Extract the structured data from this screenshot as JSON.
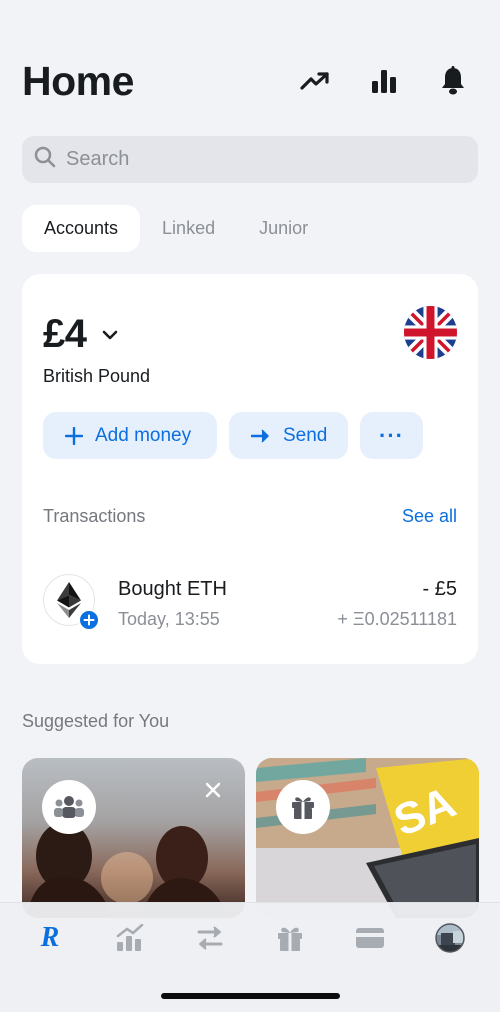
{
  "header": {
    "title": "Home",
    "icons": [
      "trending-up-icon",
      "bar-chart-icon",
      "bell-icon"
    ]
  },
  "search": {
    "placeholder": "Search",
    "value": ""
  },
  "tabs": [
    {
      "label": "Accounts",
      "active": true
    },
    {
      "label": "Linked",
      "active": false
    },
    {
      "label": "Junior",
      "active": false
    }
  ],
  "account": {
    "balance": "£4",
    "currency_name": "British Pound",
    "flag": "uk-flag-icon",
    "actions": {
      "add_money": "Add money",
      "send": "Send",
      "more": "···"
    }
  },
  "transactions": {
    "title": "Transactions",
    "see_all": "See all",
    "items": [
      {
        "name": "Bought ETH",
        "time": "Today, 13:55",
        "amount": "- £5",
        "crypto_amount": "+ Ξ0.02511181",
        "icon": "ethereum-icon"
      }
    ]
  },
  "suggested": {
    "title": "Suggested for You",
    "cards": [
      {
        "icon": "group-icon"
      },
      {
        "icon": "gift-icon"
      }
    ]
  },
  "tabbar": {
    "items": [
      "home-logo-icon",
      "stocks-icon",
      "transfer-icon",
      "rewards-icon",
      "cards-icon",
      "profile-avatar"
    ],
    "logo_text": "R"
  },
  "colors": {
    "accent": "#0c6fe0",
    "background": "#f2f3f7",
    "card": "#ffffff",
    "action_bg": "#e6f0fc"
  }
}
